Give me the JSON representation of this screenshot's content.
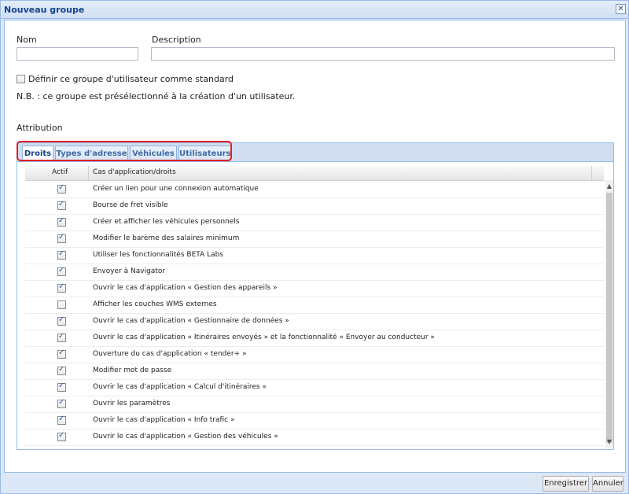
{
  "window": {
    "title": "Nouveau groupe",
    "close_glyph": "✕"
  },
  "form": {
    "name_label": "Nom",
    "name_value": "",
    "description_label": "Description",
    "description_value": "",
    "standard_checkbox_label": "Définir ce groupe d'utilisateur comme standard",
    "standard_checked": false,
    "note": "N.B. : ce groupe est présélectionné à la création d'un utilisateur.",
    "attribution_label": "Attribution"
  },
  "tabs": [
    {
      "label": "Droits",
      "active": true
    },
    {
      "label": "Types d'adresse",
      "active": false
    },
    {
      "label": "Véhicules",
      "active": false
    },
    {
      "label": "Utilisateurs",
      "active": false
    }
  ],
  "grid": {
    "columns": [
      "Actif",
      "Cas d'application/droits"
    ],
    "rows": [
      {
        "active": true,
        "label": "Créer un lien pour une connexion automatique"
      },
      {
        "active": true,
        "label": "Bourse de fret visible"
      },
      {
        "active": true,
        "label": "Créer et afficher les véhicules personnels"
      },
      {
        "active": true,
        "label": "Modifier le barème des salaires minimum"
      },
      {
        "active": true,
        "label": "Utiliser les fonctionnalités BETA Labs"
      },
      {
        "active": true,
        "label": "Envoyer à Navigator"
      },
      {
        "active": true,
        "label": "Ouvrir le cas d'application « Gestion des appareils »"
      },
      {
        "active": false,
        "label": "Afficher les couches WMS externes"
      },
      {
        "active": true,
        "label": "Ouvrir le cas d'application « Gestionnaire de données »"
      },
      {
        "active": true,
        "label": "Ouvrir le cas d'application « Itinéraires envoyés » et la fonctionnalité « Envoyer au conducteur »"
      },
      {
        "active": true,
        "label": "Ouverture du cas d'application « tender+ »"
      },
      {
        "active": true,
        "label": "Modifier mot de passe"
      },
      {
        "active": true,
        "label": "Ouvrir le cas d'application « Calcul d'itinéraires »"
      },
      {
        "active": true,
        "label": "Ouvrir les paramètres"
      },
      {
        "active": true,
        "label": "Ouvrir le cas d'application « Info trafic »"
      },
      {
        "active": true,
        "label": "Ouvrir le cas d'application « Gestion des véhicules »"
      }
    ]
  },
  "buttons": {
    "save": "Enregistrer",
    "cancel": "Annuler"
  },
  "colors": {
    "highlight": "#e02020",
    "title_text": "#15428b",
    "border": "#99bbe8"
  },
  "icons": {
    "scroll_up": "chevron-up-icon",
    "scroll_down": "chevron-down-icon"
  }
}
